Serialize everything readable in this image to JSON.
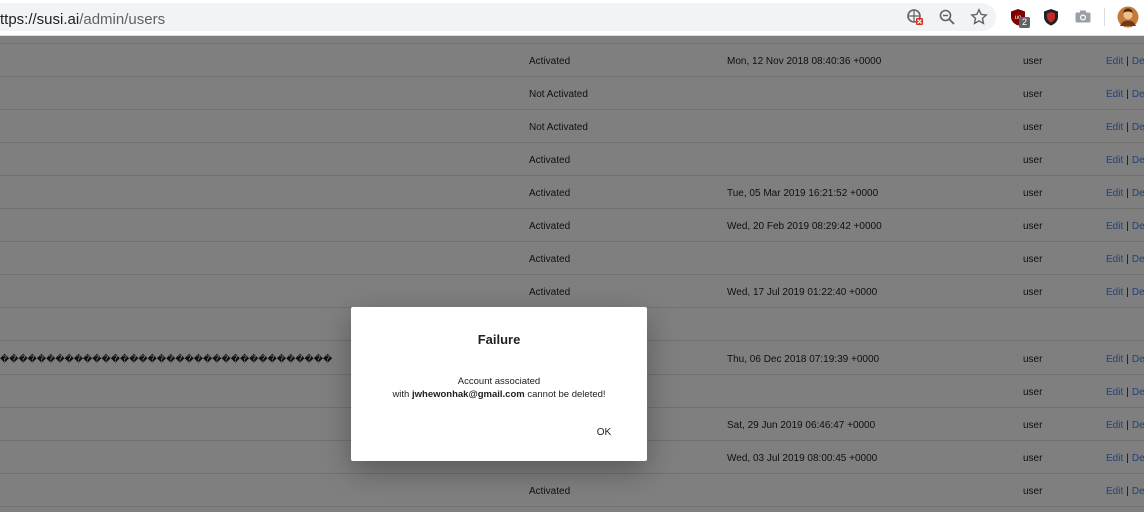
{
  "browser": {
    "url_host": "ttps://susi.ai",
    "url_path": "/admin/users",
    "extension_badge": "2",
    "icons": [
      "blocked-content-icon",
      "zoom-out-icon",
      "star-icon",
      "ublock-icon",
      "shield-icon",
      "camera-icon",
      "profile-avatar"
    ]
  },
  "table": {
    "rows": [
      {
        "status": "Activated",
        "date": "Mon, 12 Nov 2018 08:40:36 +0000",
        "role": "user",
        "edit": "Edit",
        "sep": "|",
        "del": "Del"
      },
      {
        "status": "Not Activated",
        "date": "",
        "role": "user",
        "edit": "Edit",
        "sep": "|",
        "del": "Del"
      },
      {
        "status": "Not Activated",
        "date": "",
        "role": "user",
        "edit": "Edit",
        "sep": "|",
        "del": "Del"
      },
      {
        "status": "Activated",
        "date": "",
        "role": "user",
        "edit": "Edit",
        "sep": "|",
        "del": "Del"
      },
      {
        "status": "Activated",
        "date": "Tue, 05 Mar 2019 16:21:52 +0000",
        "role": "user",
        "edit": "Edit",
        "sep": "|",
        "del": "Del"
      },
      {
        "status": "Activated",
        "date": "Wed, 20 Feb 2019 08:29:42 +0000",
        "role": "user",
        "edit": "Edit",
        "sep": "|",
        "del": "Del"
      },
      {
        "status": "Activated",
        "date": "",
        "role": "user",
        "edit": "Edit",
        "sep": "|",
        "del": "Del"
      },
      {
        "status": "Activated",
        "date": "Wed, 17 Jul 2019 01:22:40 +0000",
        "role": "user",
        "edit": "Edit",
        "sep": "|",
        "del": "Del"
      },
      {
        "status": "",
        "date": "",
        "role": "",
        "edit": "",
        "sep": "",
        "del": ""
      },
      {
        "garbled": "������������������������������������",
        "status": "",
        "date": "Thu, 06 Dec 2018 07:19:39 +0000",
        "role": "user",
        "edit": "Edit",
        "sep": "|",
        "del": "Del"
      },
      {
        "status": "",
        "date": "",
        "role": "user",
        "edit": "Edit",
        "sep": "|",
        "del": "Del"
      },
      {
        "status": "",
        "date": "Sat, 29 Jun 2019 06:46:47 +0000",
        "role": "user",
        "edit": "Edit",
        "sep": "|",
        "del": "Del"
      },
      {
        "status": "",
        "date": "Wed, 03 Jul 2019 08:00:45 +0000",
        "role": "user",
        "edit": "Edit",
        "sep": "|",
        "del": "Del"
      },
      {
        "status": "Activated",
        "date": "",
        "role": "user",
        "edit": "Edit",
        "sep": "|",
        "del": "Del"
      }
    ]
  },
  "dialog": {
    "title": "Failure",
    "line1": "Account associated",
    "line2_prefix": "with ",
    "email": "jwhewonhak@gmail.com",
    "line2_suffix": " cannot be deleted!",
    "ok_label": "OK"
  }
}
